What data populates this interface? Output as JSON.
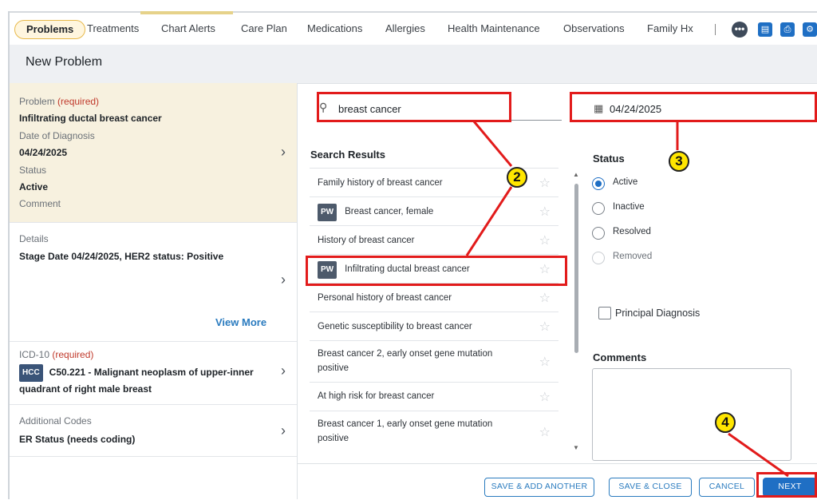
{
  "tabs": [
    {
      "label": "Problems"
    },
    {
      "label": "Treatments"
    },
    {
      "label": "Chart Alerts"
    },
    {
      "label": "Care Plan"
    },
    {
      "label": "Medications"
    },
    {
      "label": "Allergies"
    },
    {
      "label": "Health Maintenance"
    },
    {
      "label": "Observations"
    },
    {
      "label": "Family Hx"
    }
  ],
  "toolbar": {
    "more_icon": "ellipsis-icon",
    "icons": [
      "clipboard-icon",
      "print-icon",
      "settings-icon"
    ]
  },
  "header": {
    "title": "New Problem"
  },
  "left": {
    "problem": {
      "label": "Problem",
      "required": "(required)",
      "value": "Infiltrating ductal breast cancer",
      "date_label": "Date of Diagnosis",
      "date_value": "04/24/2025",
      "status_label": "Status",
      "status_value": "Active",
      "comment_label": "Comment"
    },
    "details": {
      "label": "Details",
      "value": "Stage Date 04/24/2025, HER2 status: Positive",
      "view_more": "View More"
    },
    "icd": {
      "label": "ICD-10",
      "required": "(required)",
      "badge": "HCC",
      "value": "C50.221 - Malignant neoplasm of upper-inner quadrant of right male breast"
    },
    "additional": {
      "label": "Additional Codes",
      "value": "ER Status (needs coding)"
    }
  },
  "search": {
    "value": "breast cancer"
  },
  "results": {
    "title": "Search Results",
    "items": [
      {
        "text": "Family history of breast cancer",
        "badge": ""
      },
      {
        "text": "Breast cancer, female",
        "badge": "PW"
      },
      {
        "text": "History of breast cancer",
        "badge": ""
      },
      {
        "text": "Infiltrating ductal breast cancer",
        "badge": "PW"
      },
      {
        "text": "Personal history of breast cancer",
        "badge": ""
      },
      {
        "text": "Genetic susceptibility to breast cancer",
        "badge": ""
      },
      {
        "text": "Breast cancer 2, early onset gene mutation positive",
        "badge": ""
      },
      {
        "text": "At high risk for breast cancer",
        "badge": ""
      },
      {
        "text": "Breast cancer 1, early onset gene mutation positive",
        "badge": ""
      }
    ]
  },
  "date": {
    "value": "04/24/2025"
  },
  "status": {
    "label": "Status",
    "options": [
      {
        "label": "Active",
        "state": "checked"
      },
      {
        "label": "Inactive",
        "state": "unchecked"
      },
      {
        "label": "Resolved",
        "state": "unchecked"
      },
      {
        "label": "Removed",
        "state": "disabled"
      }
    ]
  },
  "principal": {
    "label": "Principal Diagnosis"
  },
  "comments": {
    "label": "Comments"
  },
  "footer": {
    "save_add": "SAVE & ADD ANOTHER",
    "save_close": "SAVE & CLOSE",
    "cancel": "CANCEL",
    "next": "NEXT"
  },
  "annotations": {
    "badge2": "2",
    "badge3": "3",
    "badge4": "4"
  },
  "colors": {
    "accent": "#1f6fc4",
    "annotation": "#e21b1b",
    "badge": "#ffe600",
    "problem_card": "#f7f1df"
  }
}
